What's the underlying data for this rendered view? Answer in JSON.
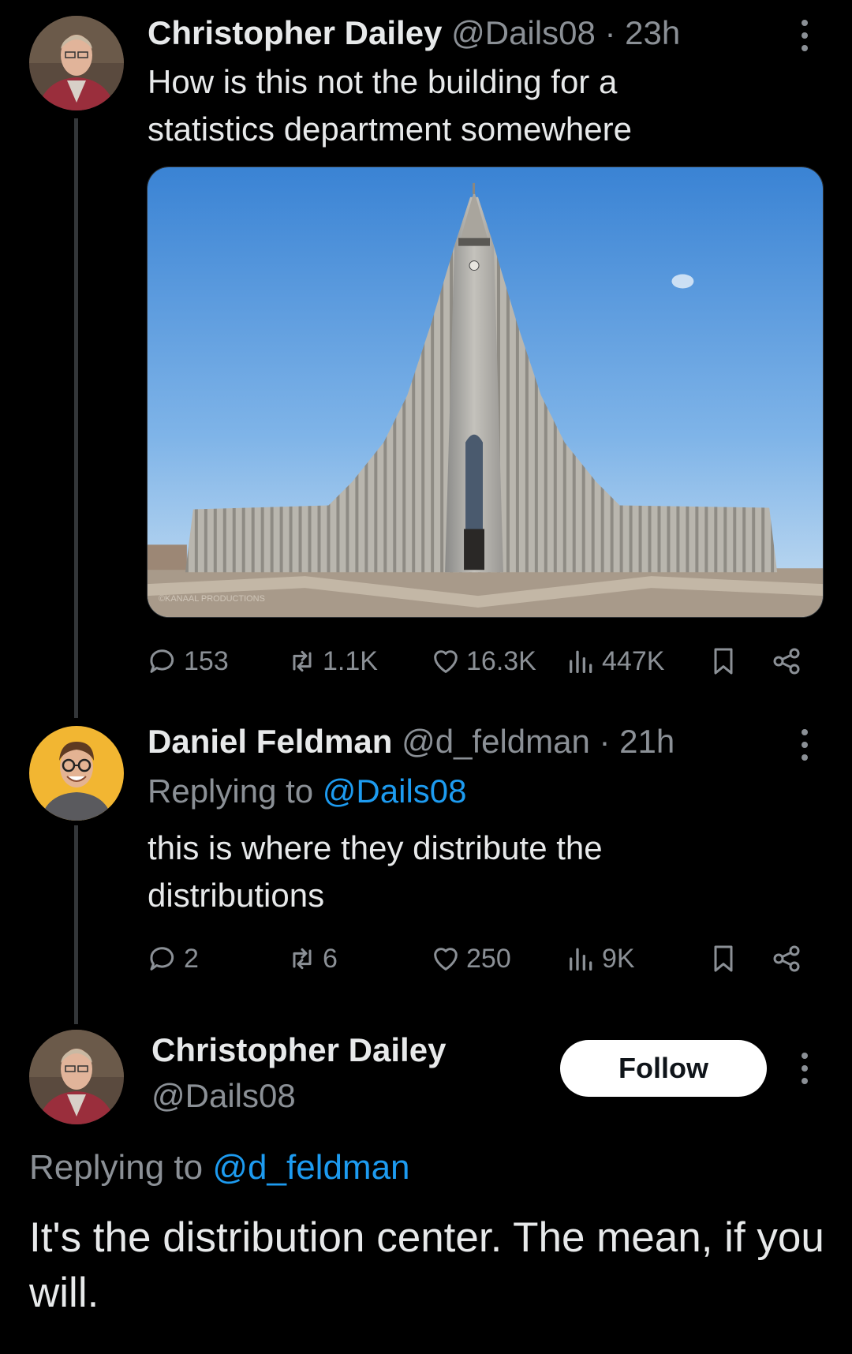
{
  "tweets": [
    {
      "name": "Christopher Dailey",
      "handle": "@Dails08",
      "time": "· 23h",
      "text": "How is this not the building for a statistics department somewhere",
      "stats": {
        "replies": "153",
        "reposts": "1.1K",
        "likes": "16.3K",
        "views": "447K"
      }
    },
    {
      "name": "Daniel Feldman",
      "handle": "@d_feldman",
      "time": "· 21h",
      "replying_prefix": "Replying to",
      "replying_to": "@Dails08",
      "text": "this is where they distribute the distributions",
      "stats": {
        "replies": "2",
        "reposts": "6",
        "likes": "250",
        "views": "9K"
      }
    }
  ],
  "focused": {
    "name": "Christopher Dailey",
    "handle": "@Dails08",
    "follow_label": "Follow",
    "replying_prefix": "Replying to",
    "replying_to": "@d_feldman",
    "text": "It's the distribution center. The mean, if you will."
  },
  "media": {
    "watermark": "©KANAAL PRODUCTIONS"
  },
  "icons": [
    "reply-icon",
    "repost-icon",
    "like-icon",
    "views-icon",
    "bookmark-icon",
    "share-icon",
    "more-icon"
  ],
  "colors": {
    "background": "#000000",
    "text": "#e7e9ea",
    "muted": "#8b9096",
    "link": "#1d9bf0",
    "follow_bg": "#ffffff"
  }
}
